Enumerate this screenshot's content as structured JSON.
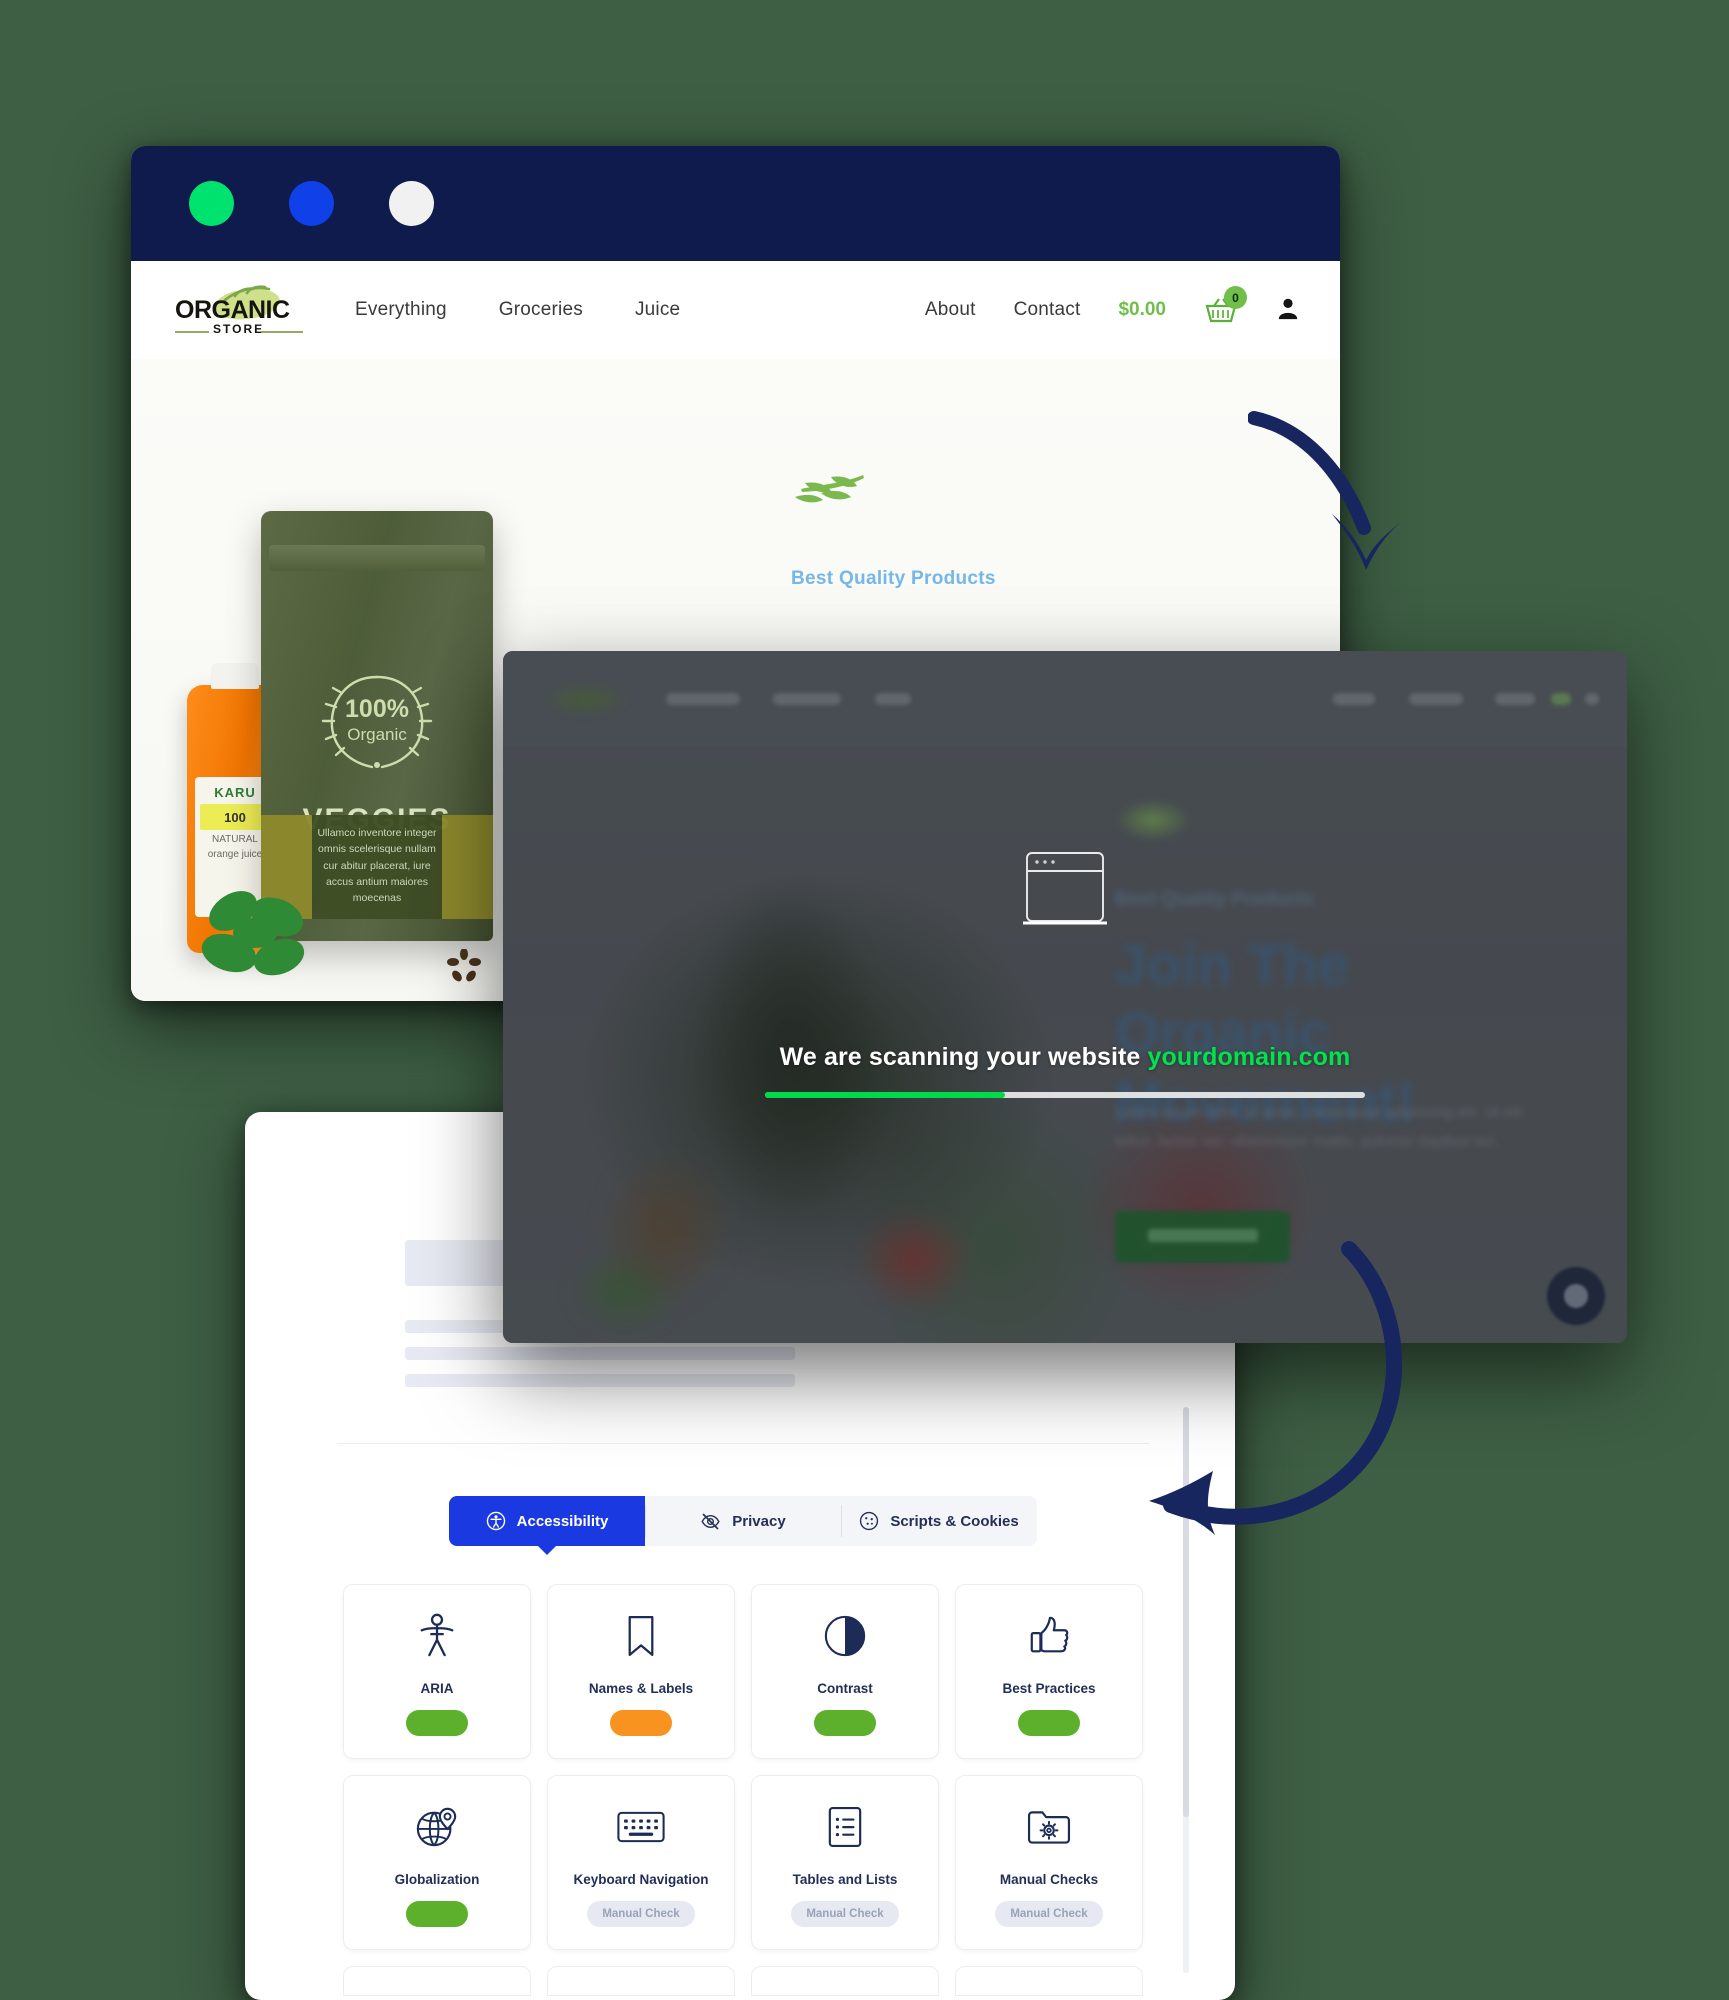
{
  "window_controls": [
    {
      "name": "traffic-light-green",
      "color": "#00e26e"
    },
    {
      "name": "traffic-light-blue",
      "color": "#1040e8"
    },
    {
      "name": "traffic-light-white",
      "color": "#f1f1f1"
    }
  ],
  "site": {
    "logo": {
      "word_main": "ORGANIC",
      "word_sub": "STORE"
    },
    "nav_left": [
      "Everything",
      "Groceries",
      "Juice"
    ],
    "nav_right": [
      "About",
      "Contact"
    ],
    "cart": {
      "price": "$0.00",
      "count": "0"
    },
    "hero": {
      "eyebrow": "Best Quality Products",
      "title": "Join The Organic Movement!",
      "body": "Lorem ipsum dolor sit amet, consectetur adipiscing elit. Ut elit tellus, luctus nec ullamcorper mattis, pulvinar dapibus leo.",
      "cta": "Shop Now"
    },
    "product": {
      "pouch_badge_pct": "100%",
      "pouch_badge_word": "Organic",
      "pouch_name": "VEGGIES",
      "pouch_blurb": "Ullamco inventore integer omnis scelerisque nullam cur abitur placerat, iure accus antium maiores moecenas",
      "bottle_brand": "KARU",
      "bottle_badge": "100",
      "bottle_line1": "NATURAL",
      "bottle_line2": "orange juice"
    }
  },
  "scanner": {
    "message_prefix": "We are scanning your website",
    "domain": "yourdomain.com",
    "progress_percent": 40,
    "accent_color": "#00d94a",
    "window_icon": "browser-window-icon",
    "chat_widget": "chat-bubble-icon"
  },
  "report": {
    "tabs": [
      {
        "label": "Accessibility",
        "icon": "accessibility-person-icon",
        "active": true
      },
      {
        "label": "Privacy",
        "icon": "eye-off-icon",
        "active": false
      },
      {
        "label": "Scripts & Cookies",
        "icon": "cookie-icon",
        "active": false
      }
    ],
    "cards": [
      {
        "label": "ARIA",
        "icon": "accessibility-person-icon",
        "status": "pass",
        "status_label": ""
      },
      {
        "label": "Names & Labels",
        "icon": "bookmark-icon",
        "status": "warn",
        "status_label": ""
      },
      {
        "label": "Contrast",
        "icon": "contrast-circle-icon",
        "status": "pass",
        "status_label": ""
      },
      {
        "label": "Best Practices",
        "icon": "thumbs-up-icon",
        "status": "pass",
        "status_label": ""
      },
      {
        "label": "Globalization",
        "icon": "globe-pin-icon",
        "status": "pass",
        "status_label": ""
      },
      {
        "label": "Keyboard Navigation",
        "icon": "keyboard-icon",
        "status": "manual",
        "status_label": "Manual Check"
      },
      {
        "label": "Tables and Lists",
        "icon": "list-document-icon",
        "status": "manual",
        "status_label": "Manual Check"
      },
      {
        "label": "Manual Checks",
        "icon": "folder-gear-icon",
        "status": "manual",
        "status_label": "Manual Check"
      }
    ],
    "colors": {
      "pass": "#5cb02c",
      "warn": "#f7931e",
      "manual_bg": "#e6e9f2",
      "tab_active": "#1b39e0"
    }
  }
}
